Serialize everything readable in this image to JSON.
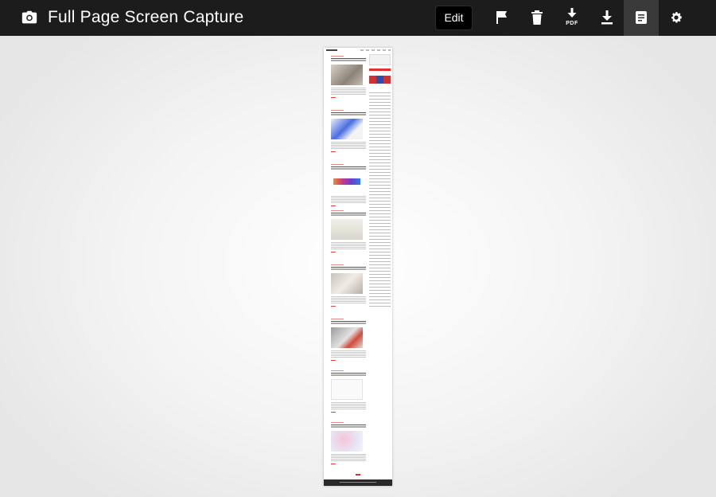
{
  "header": {
    "title": "Full Page Screen Capture",
    "edit_label": "Edit",
    "pdf_label": "PDF"
  },
  "toolbar": {
    "icons": [
      "camera-icon",
      "flag-icon",
      "trash-icon",
      "download-pdf-icon",
      "download-icon",
      "notes-icon",
      "gear-icon"
    ],
    "active": "notes-icon"
  },
  "capture": {
    "description_note": "",
    "posts_count": 8
  },
  "colors": {
    "topbar": "#1c1c1c",
    "active_tool": "#3a3a3a",
    "accent": "#cc3333"
  }
}
